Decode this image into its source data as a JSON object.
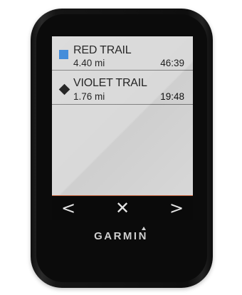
{
  "routes": [
    {
      "name": "RED TRAIL",
      "distance": "4.40 mi",
      "time": "46:39",
      "icon": "square-icon",
      "icon_color": "#2d7fd6"
    },
    {
      "name": "VIOLET TRAIL",
      "distance": "1.76 mi",
      "time": "19:48",
      "icon": "diamond-icon",
      "icon_color": "#111111"
    }
  ],
  "navbar": {
    "prev_glyph": "<",
    "close_glyph": "✕",
    "next_glyph": ">"
  },
  "device": {
    "brand": "GARMIN"
  },
  "colors": {
    "screen_bg": "#d7d7d7",
    "accent_line": "#c8623a",
    "bezel": "#0b0b0b"
  }
}
